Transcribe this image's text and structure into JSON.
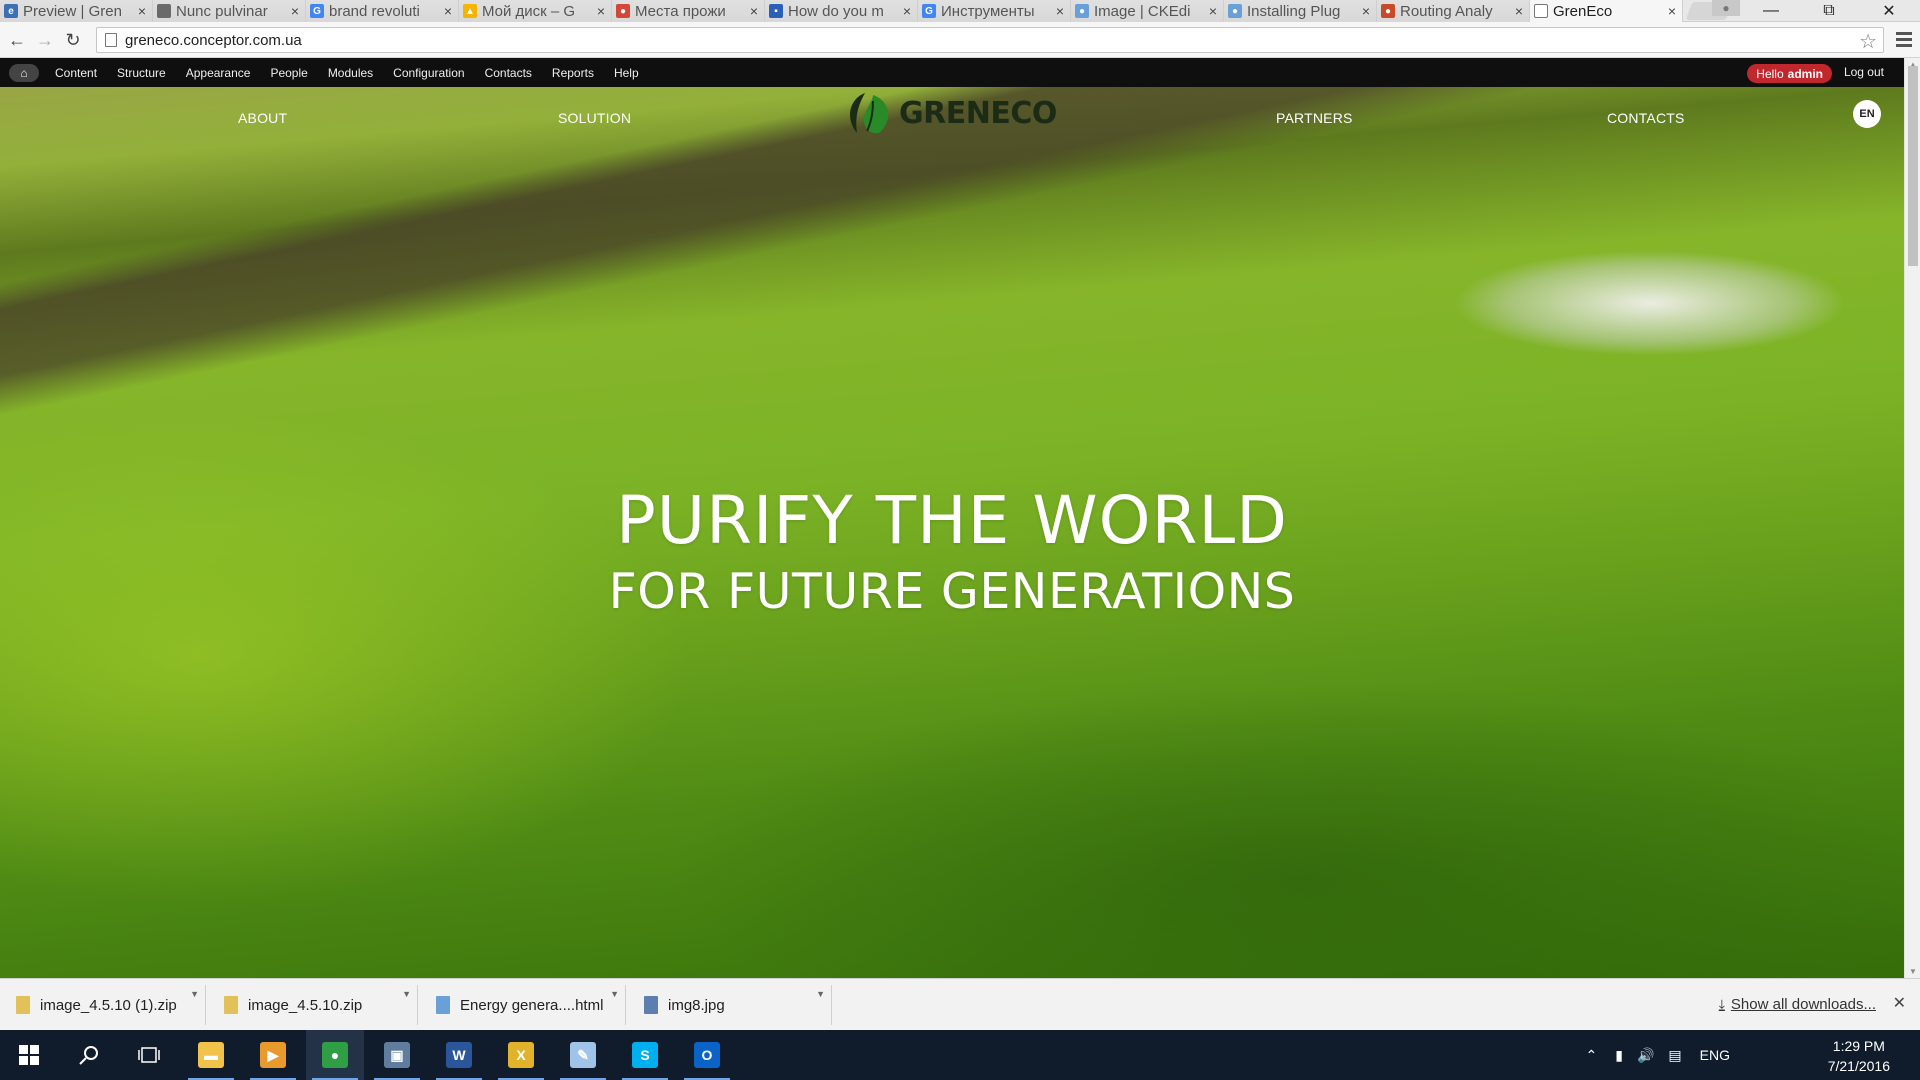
{
  "browser": {
    "tabs": [
      {
        "title": "Preview | Gren",
        "fav_color": "#3b6fb6",
        "fav_glyph": "e"
      },
      {
        "title": "Nunc pulvinar",
        "fav_color": "#6a6a6a",
        "fav_glyph": ""
      },
      {
        "title": "brand revoluti",
        "fav_color": "#4285f4",
        "fav_glyph": "G"
      },
      {
        "title": "Мой диск – G",
        "fav_color": "#f4b400",
        "fav_glyph": "▲"
      },
      {
        "title": "Места прожи",
        "fav_color": "#d44638",
        "fav_glyph": "●"
      },
      {
        "title": "How do you m",
        "fav_color": "#2b5fb8",
        "fav_glyph": "▪"
      },
      {
        "title": "Инструменты",
        "fav_color": "#4285f4",
        "fav_glyph": "G"
      },
      {
        "title": "Image | CKEdi",
        "fav_color": "#6aa0d8",
        "fav_glyph": "●"
      },
      {
        "title": "Installing Plug",
        "fav_color": "#6aa0d8",
        "fav_glyph": "●"
      },
      {
        "title": "Routing Analy",
        "fav_color": "#c84a28",
        "fav_glyph": "●"
      },
      {
        "title": "GrenEco",
        "fav_color": "#ffffff",
        "fav_glyph": ""
      }
    ],
    "url": "greneco.conceptor.com.ua"
  },
  "admin_toolbar": {
    "items": [
      "Content",
      "Structure",
      "Appearance",
      "People",
      "Modules",
      "Configuration",
      "Contacts",
      "Reports",
      "Help"
    ],
    "hello": "Hello",
    "user": "admin",
    "logout": "Log out"
  },
  "site": {
    "nav": {
      "about": "ABOUT",
      "solution": "SOLUTION",
      "partners": "PARTNERS",
      "contacts": "CONTACTS"
    },
    "logo_text": "GRENECO",
    "language": "EN",
    "headline_1": "PURIFY THE WORLD",
    "headline_2": "FOR FUTURE GENERATIONS"
  },
  "downloads": {
    "items": [
      {
        "name": "image_4.5.10 (1).zip",
        "icon_color": "#e2c15a"
      },
      {
        "name": "image_4.5.10.zip",
        "icon_color": "#e2c15a"
      },
      {
        "name": "Energy genera....html",
        "icon_color": "#6aa0d8"
      },
      {
        "name": "img8.jpg",
        "icon_color": "#5c7fb0"
      }
    ],
    "show_all": "Show all downloads..."
  },
  "taskbar": {
    "apps": [
      {
        "name": "file-explorer",
        "color": "#f2c34a",
        "glyph": "▬"
      },
      {
        "name": "media-player",
        "color": "#e89a2c",
        "glyph": "▶"
      },
      {
        "name": "chrome",
        "color": "#2f9e44",
        "glyph": "●"
      },
      {
        "name": "app-window",
        "color": "#607d9e",
        "glyph": "▣"
      },
      {
        "name": "word",
        "color": "#2b579a",
        "glyph": "W"
      },
      {
        "name": "app-x",
        "color": "#e0b32a",
        "glyph": "X"
      },
      {
        "name": "paint",
        "color": "#a0c4e8",
        "glyph": "✎"
      },
      {
        "name": "skype",
        "color": "#00aff0",
        "glyph": "S"
      },
      {
        "name": "outlook",
        "color": "#0a64c8",
        "glyph": "O"
      }
    ],
    "language": "ENG",
    "time": "1:29 PM",
    "date": "7/21/2016"
  }
}
